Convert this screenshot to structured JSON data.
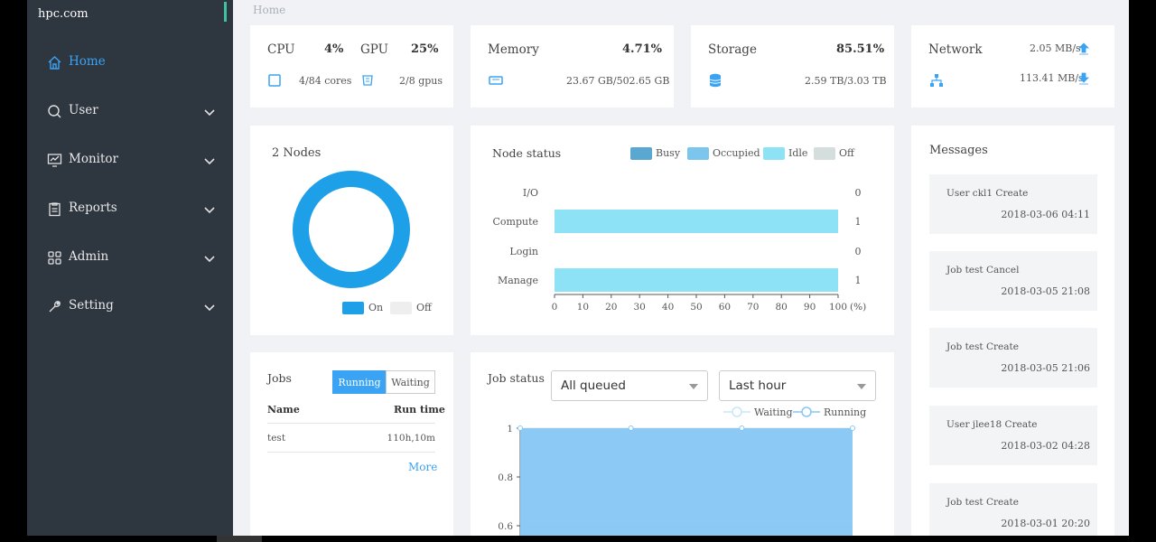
{
  "sidebar": {
    "brand": "hpc.com",
    "items": [
      {
        "label": "Home"
      },
      {
        "label": "User"
      },
      {
        "label": "Monitor"
      },
      {
        "label": "Reports"
      },
      {
        "label": "Admin"
      },
      {
        "label": "Setting"
      }
    ]
  },
  "breadcrumb": "Home",
  "stats": {
    "cpu": {
      "label": "CPU",
      "value": "4%",
      "detail": "4/84 cores"
    },
    "gpu": {
      "label": "GPU",
      "value": "25%",
      "detail": "2/8 gpus"
    },
    "memory": {
      "label": "Memory",
      "value": "4.71%",
      "detail": "23.67 GB/502.65 GB"
    },
    "storage": {
      "label": "Storage",
      "value": "85.51%",
      "detail": "2.59 TB/3.03 TB"
    },
    "network": {
      "label": "Network",
      "up": "2.05 MB/s",
      "down": "113.41 MB/s"
    }
  },
  "nodes": {
    "title": "2 Nodes",
    "on_fraction": 1.0,
    "legend_on": "On",
    "legend_off": "Off",
    "color_on": "#1ea0e9",
    "color_off": "#eeeeee"
  },
  "node_status": {
    "title": "Node status",
    "legend": [
      {
        "label": "Busy",
        "color": "#5aa8d2"
      },
      {
        "label": "Occupied",
        "color": "#7cc5ec"
      },
      {
        "label": "Idle",
        "color": "#8de3f5"
      },
      {
        "label": "Off",
        "color": "#d4dedd"
      }
    ],
    "unit": "(%)"
  },
  "jobs": {
    "title": "Jobs",
    "tab_running": "Running",
    "tab_waiting": "Waiting",
    "col_name": "Name",
    "col_runtime": "Run time",
    "rows": [
      {
        "name": "test",
        "runtime": "110h,10m"
      }
    ],
    "more": "More"
  },
  "job_status": {
    "title": "Job status",
    "filter_queue": "All queued",
    "filter_time": "Last hour",
    "legend_waiting": "Waiting",
    "legend_running": "Running"
  },
  "messages": {
    "title": "Messages",
    "items": [
      {
        "text": "User ckl1 Create",
        "date": "2018-03-06 04:11"
      },
      {
        "text": "Job test Cancel",
        "date": "2018-03-05 21:08"
      },
      {
        "text": "Job test Create",
        "date": "2018-03-05 21:06"
      },
      {
        "text": "User jlee18 Create",
        "date": "2018-03-02 04:28"
      },
      {
        "text": "Job test Create",
        "date": "2018-03-01 20:20"
      }
    ]
  },
  "chart_data": [
    {
      "type": "bar",
      "orientation": "horizontal",
      "title": "Node status",
      "categories": [
        "I/O",
        "Compute",
        "Login",
        "Manage"
      ],
      "values": [
        0,
        100,
        0,
        100
      ],
      "counts": [
        "0",
        "1",
        "0",
        "1"
      ],
      "xlim": [
        0,
        100
      ],
      "xticks": [
        "0",
        "10",
        "20",
        "30",
        "40",
        "50",
        "60",
        "70",
        "80",
        "90",
        "100"
      ],
      "bar_color": "#8de3f5"
    },
    {
      "type": "area",
      "title": "Job status",
      "series": [
        {
          "name": "Waiting",
          "values": [
            1,
            1,
            1,
            1
          ]
        },
        {
          "name": "Running",
          "values": [
            1,
            1,
            1,
            1
          ]
        }
      ],
      "yticks": [
        "1",
        "0.8",
        "0.6"
      ],
      "ylim": [
        0.55,
        1
      ],
      "grid": true,
      "fill_color": "#86c6f4"
    }
  ]
}
